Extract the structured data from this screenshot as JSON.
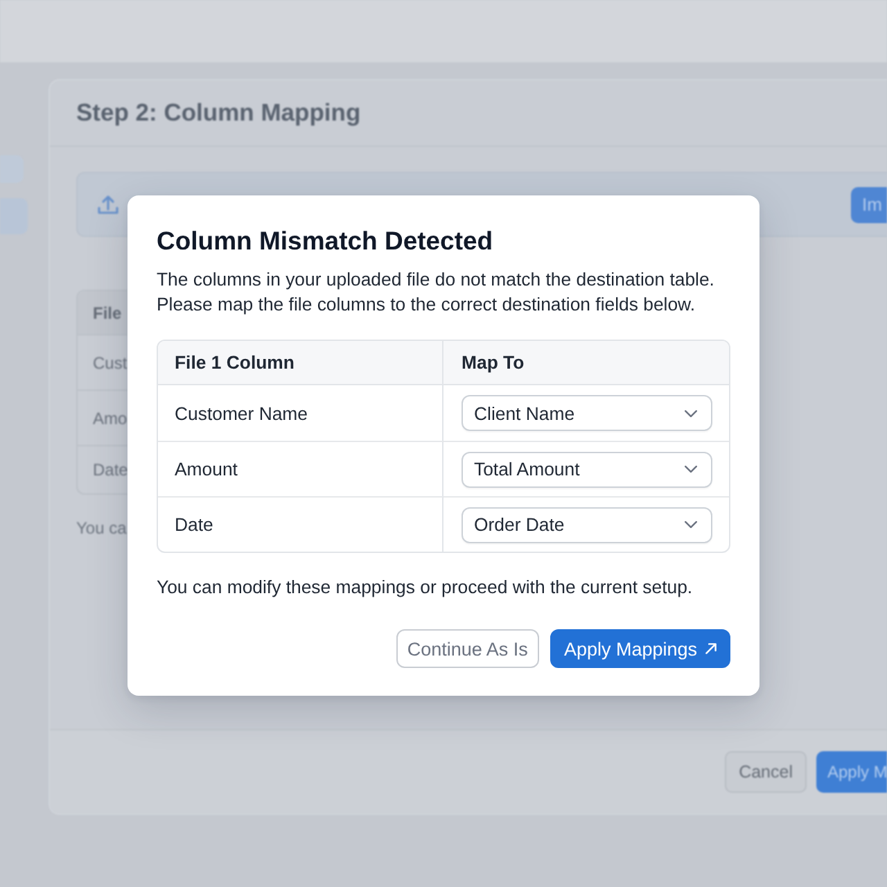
{
  "background": {
    "title": "Step 2: Column Mapping",
    "upload_bar": {
      "button": "Im"
    },
    "table": {
      "columns": [
        "File"
      ],
      "rows": [
        "Cust",
        "Amo",
        "Date"
      ]
    },
    "note": "You ca",
    "buttons": [
      {
        "label": "Cancel",
        "kind": "secondary"
      },
      {
        "label": "Apply M",
        "kind": "primary"
      }
    ]
  },
  "dialog": {
    "title": "Column Mismatch Detected",
    "description": "The columns in your uploaded file do not match the destination table. Please map the file columns to the correct destination fields below.",
    "table": {
      "columns": [
        "File 1 Column",
        "Map To"
      ],
      "rows": [
        {
          "file_column": "Customer Name",
          "map_to": "Client Name"
        },
        {
          "file_column": "Amount",
          "map_to": "Total Amount"
        },
        {
          "file_column": "Date",
          "map_to": "Order Date"
        }
      ]
    },
    "note": "You can modify these mappings or proceed with the current setup.",
    "buttons": [
      {
        "label": "Continue As Is",
        "kind": "secondary"
      },
      {
        "label": "Apply Mappings",
        "kind": "primary"
      }
    ]
  }
}
